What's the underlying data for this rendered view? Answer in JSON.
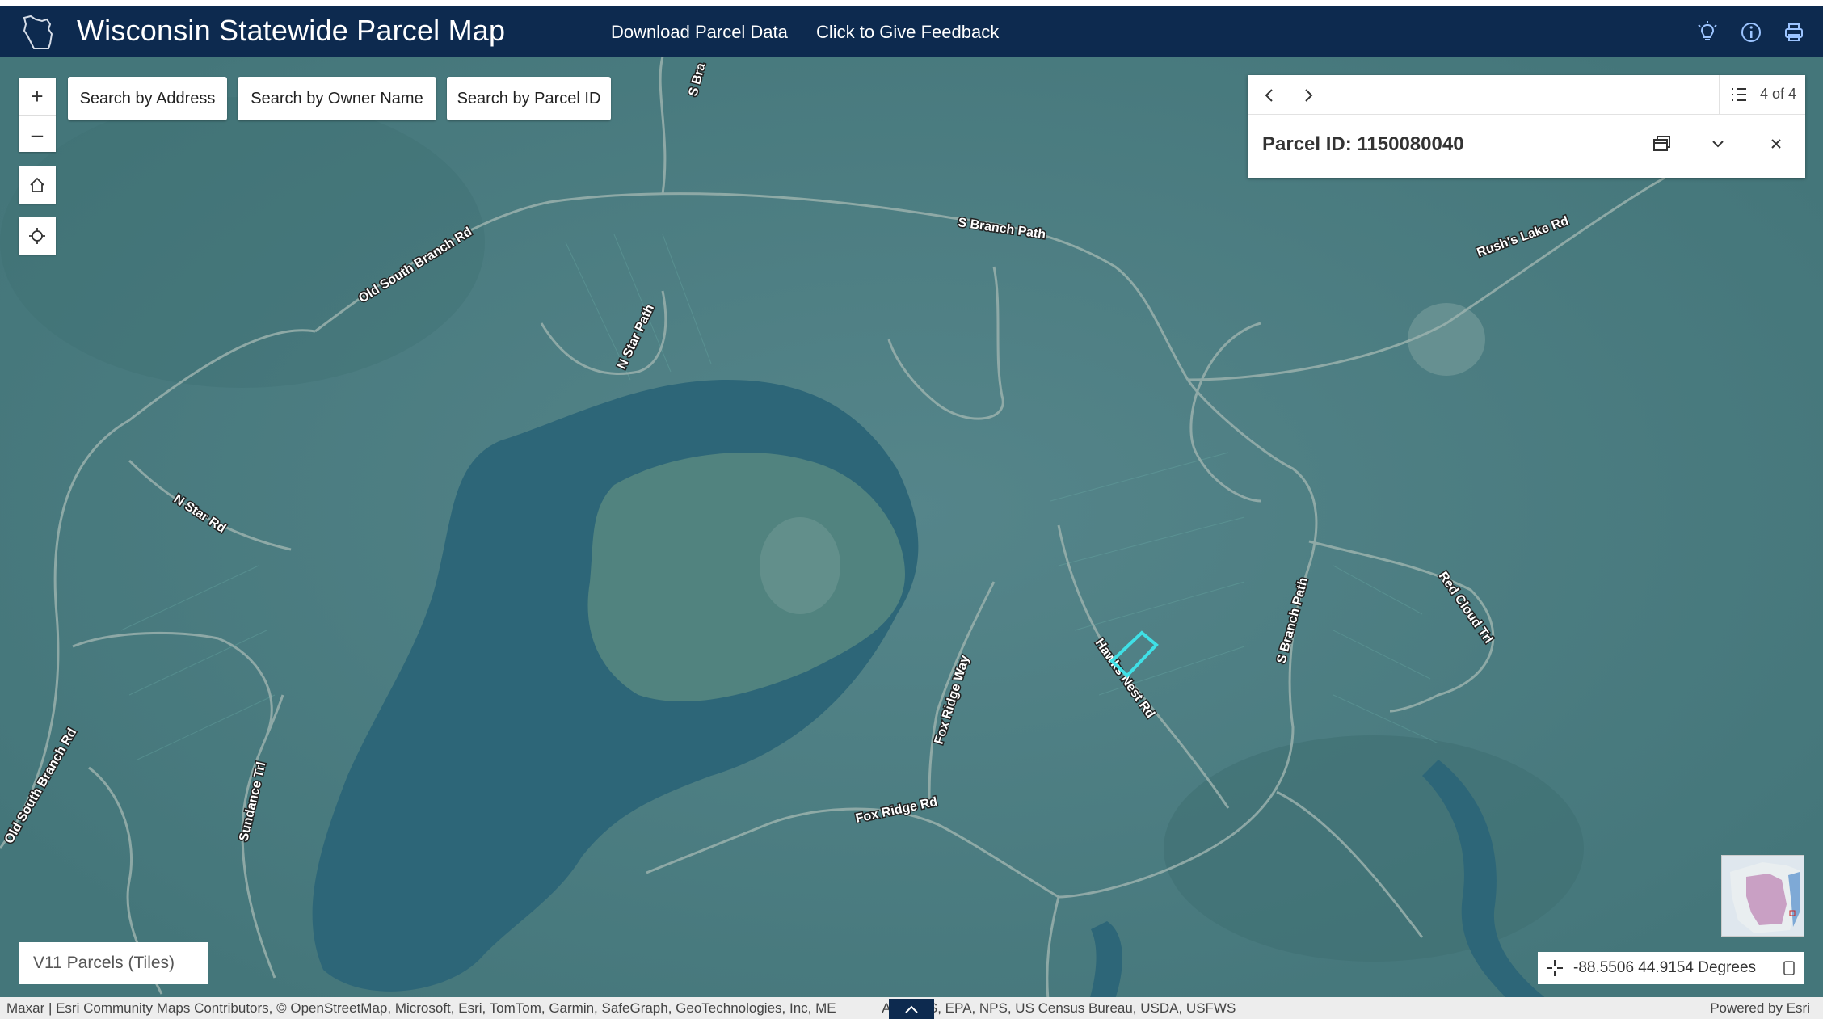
{
  "header": {
    "title": "Wisconsin Statewide Parcel Map",
    "nav": [
      "Download Parcel Data",
      "Click to Give Feedback"
    ],
    "icons": [
      "lightbulb-icon",
      "info-icon",
      "print-icon"
    ]
  },
  "search_buttons": [
    "Search by Address",
    "Search by Owner Name",
    "Search by Parcel ID"
  ],
  "popup": {
    "count": "4 of 4",
    "title": "Parcel ID: 1150080040"
  },
  "map": {
    "road_labels": [
      "S Branch Path",
      "Old South Branch Rd",
      "N Star Path",
      "Rush's Lake Rd",
      "N Star Rd",
      "Red Cloud Trl",
      "S Branch Path",
      "Hawks Nest Rd",
      "Fox Ridge Way",
      "Fox Ridge Rd",
      "Sundance Trl",
      "Old South Branch Rd",
      "S Bra"
    ],
    "highlight_color": "#3fe0e6"
  },
  "legend": {
    "label": "V11 Parcels (Tiles)"
  },
  "coordinates": {
    "text": "-88.5506 44.9154 Degrees"
  },
  "attribution": {
    "left": "Maxar | Esri Community Maps Contributors, © OpenStreetMap, Microsoft, Esri, TomTom, Garmin, SafeGraph, GeoTechnologies, Inc, ME            A, USGS, EPA, NPS, US Census Bureau, USDA, USFWS",
    "right": "Powered by Esri"
  },
  "colors": {
    "header": "#0d2a4f",
    "map_base": "#4a7a7d",
    "water": "#2d6678"
  }
}
